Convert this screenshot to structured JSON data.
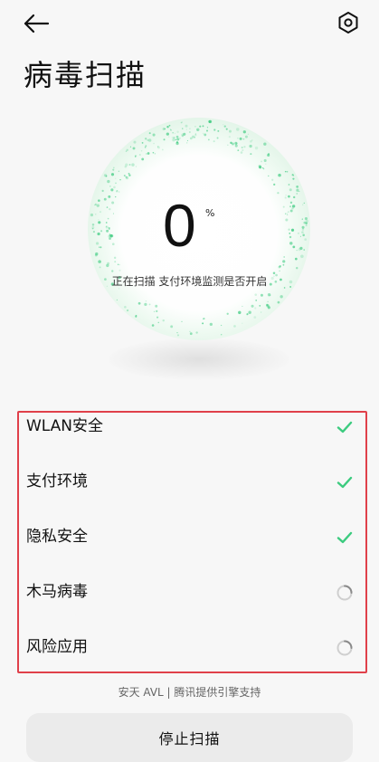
{
  "header": {
    "back_icon": "arrow-left-icon",
    "settings_icon": "gear-hexagon-icon",
    "title": "病毒扫描"
  },
  "scan": {
    "progress_value": "0",
    "progress_unit": "%",
    "progress_fraction": 0,
    "status": "正在扫描 支付环境监测是否开启",
    "accent_color": "#3ccb7f"
  },
  "checks": [
    {
      "label": "WLAN安全",
      "state": "done"
    },
    {
      "label": "支付环境",
      "state": "done"
    },
    {
      "label": "隐私安全",
      "state": "done"
    },
    {
      "label": "木马病毒",
      "state": "pending"
    },
    {
      "label": "风险应用",
      "state": "pending"
    }
  ],
  "footer": {
    "engine_note": "安天 AVL | 腾讯提供引擎支持",
    "stop_label": "停止扫描"
  }
}
